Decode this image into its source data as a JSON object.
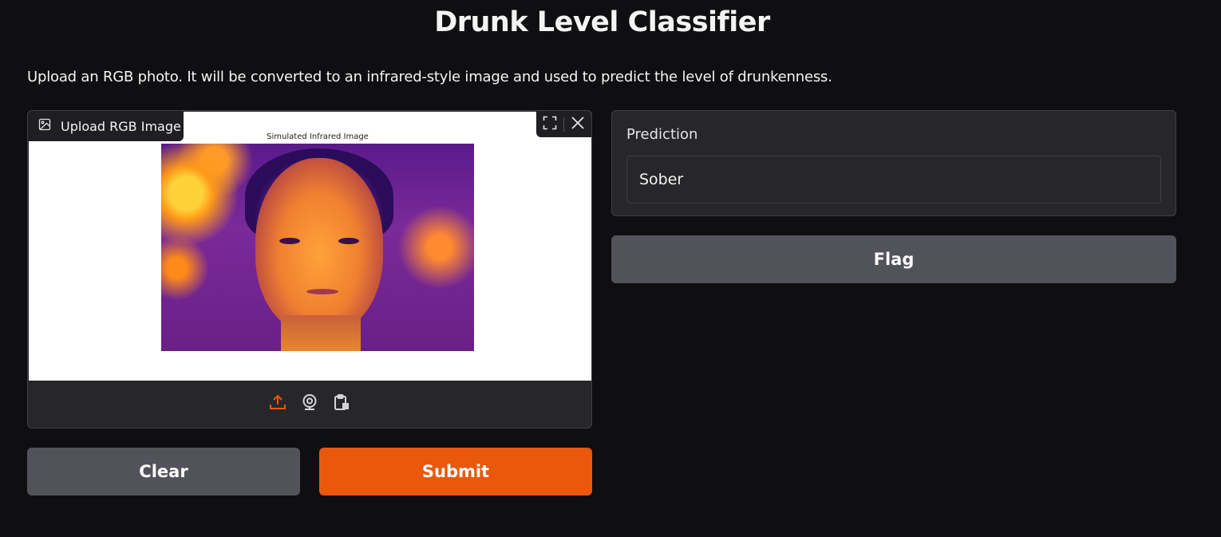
{
  "header": {
    "title": "Drunk Level Classifier",
    "description": "Upload an RGB photo. It will be converted to an infrared-style image and used to predict the level of drunkenness."
  },
  "image_input": {
    "label": "Upload RGB Image",
    "preview_title": "Simulated Infrared Image",
    "tools": [
      "fullscreen-icon",
      "close-icon"
    ],
    "sources": [
      "upload-icon",
      "webcam-icon",
      "clipboard-icon"
    ],
    "active_source_color": "#ea580c"
  },
  "actions": {
    "clear_label": "Clear",
    "submit_label": "Submit",
    "flag_label": "Flag"
  },
  "output": {
    "label": "Prediction",
    "value": "Sober"
  },
  "colors": {
    "background": "#0f0f11",
    "panel": "#27272a",
    "primary": "#ea580c",
    "secondary": "#52525b"
  }
}
